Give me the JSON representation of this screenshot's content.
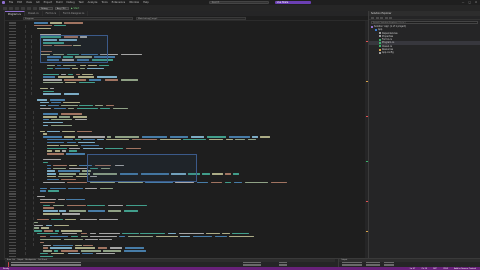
{
  "window": {
    "menu": [
      "File",
      "Edit",
      "View",
      "Git",
      "Project",
      "Build",
      "Debug",
      "Test",
      "Analyze",
      "Tools",
      "Extensions",
      "Window",
      "Help"
    ],
    "search_placeholder": "Search",
    "live_share_label": "Live Share"
  },
  "toolbar": {
    "config": "Debug",
    "platform": "Any CPU",
    "run_label": "▶ Start"
  },
  "editor": {
    "tabs": [
      "Program.cs",
      "Class1.cs",
      "Form1.cs",
      "Form1.Designer.cs"
    ],
    "active_tab": "Program.cs",
    "nav": [
      "Program",
      "Main(string[] args)"
    ]
  },
  "solution_explorer": {
    "title": "Solution Explorer",
    "search_placeholder": "Search Solution Explorer (Ctrl+;)",
    "nodes": [
      {
        "label": "Solution 'App' (1 of 1 project)",
        "depth": 0,
        "color": "#8f6fd0"
      },
      {
        "label": "App",
        "depth": 1,
        "color": "#3a7bd5"
      },
      {
        "label": "Dependencies",
        "depth": 2,
        "color": "#9e9e9e"
      },
      {
        "label": "Properties",
        "depth": 2,
        "color": "#9e9e9e"
      },
      {
        "label": "Form1.cs",
        "depth": 2,
        "color": "#3bb36b"
      },
      {
        "label": "Program.cs",
        "depth": 2,
        "color": "#3bb36b",
        "selected": true
      },
      {
        "label": "Class1.cs",
        "depth": 2,
        "color": "#3bb36b"
      },
      {
        "label": "Resources",
        "depth": 2,
        "color": "#d9a34a"
      },
      {
        "label": "App.config",
        "depth": 2,
        "color": "#9e9e9e"
      }
    ]
  },
  "error_list": {
    "tabs": [
      "Error List",
      "Output",
      "Breakpoints",
      "Call Stack"
    ],
    "row_count": 5
  },
  "output": {
    "title": "Output"
  },
  "status": {
    "left": "Ready",
    "items": [
      "Ln 57",
      "Ch 23",
      "SPC",
      "CRLF",
      "Add to Source Control"
    ]
  },
  "colors": {
    "accent": "#68217a",
    "keyword": "#569cd6",
    "type": "#4ec9b0",
    "string": "#ce9178",
    "method": "#dcdcaa",
    "number": "#b5cea8",
    "identifier": "#9cdcfe",
    "error": "#e05252"
  }
}
